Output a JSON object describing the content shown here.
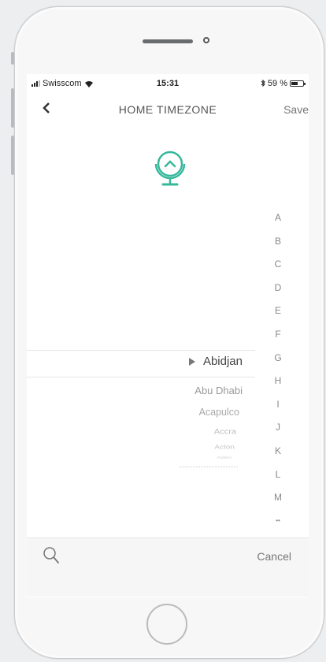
{
  "status_bar": {
    "carrier": "Swisscom",
    "time": "15:31",
    "battery": "59 %",
    "battery_level": 0.59
  },
  "nav": {
    "back_icon": "chevron-left-icon",
    "title": "HOME TIMEZONE",
    "save_label": "Save"
  },
  "header_icon": "globe-icon",
  "colors": {
    "accent": "#35b89b"
  },
  "alphabet_index": [
    "A",
    "B",
    "C",
    "D",
    "E",
    "F",
    "G",
    "H",
    "I",
    "J",
    "K",
    "L",
    "M",
    "••"
  ],
  "timezone_picker": {
    "selected": "Abidjan",
    "items": [
      "Abidjan",
      "Abu Dhabi",
      "Acapulco",
      "Accra",
      "Acton",
      "Aden"
    ]
  },
  "bottom_bar": {
    "search_icon": "search-icon",
    "cancel_label": "Cancel"
  }
}
